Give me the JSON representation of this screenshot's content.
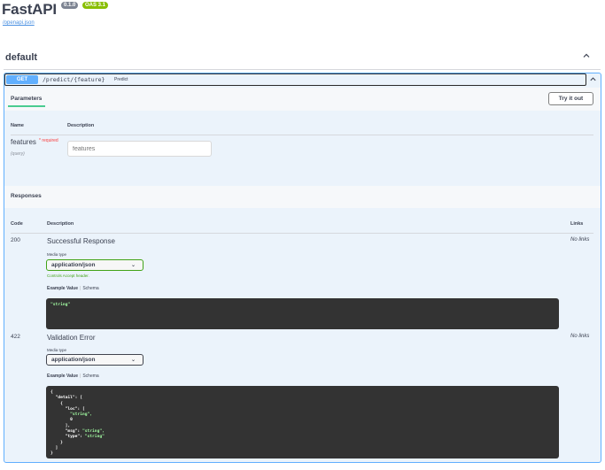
{
  "app": {
    "title": "FastAPI",
    "version_badge": "0.1.0",
    "oas_badge": "OAS 3.1",
    "spec_link": "/openapi.json"
  },
  "tag": {
    "name": "default",
    "chevron_icon": "chevron-up-icon"
  },
  "operation": {
    "method": "GET",
    "path": "/predict/{feature}",
    "summary": "Predict",
    "color": "#61affe"
  },
  "parameters": {
    "tab_label": "Parameters",
    "try_button": "Try it out",
    "col_name": "Name",
    "col_description": "Description",
    "items": [
      {
        "name": "features",
        "required_mark": "*",
        "required_label": "required",
        "in": "(query)",
        "placeholder": "features"
      }
    ]
  },
  "responses": {
    "title": "Responses",
    "col_code": "Code",
    "col_description": "Description",
    "col_links": "Links",
    "items": [
      {
        "code": "200",
        "description": "Successful Response",
        "links": "No links",
        "media_type_label": "Media type",
        "media_type": "application/json",
        "controls_note": "Controls Accept header.",
        "example_tab": "Example Value",
        "schema_tab": "Schema",
        "example": "\"string\""
      },
      {
        "code": "422",
        "description": "Validation Error",
        "links": "No links",
        "media_type_label": "Media type",
        "media_type": "application/json",
        "example_tab": "Example Value",
        "schema_tab": "Schema",
        "example_lines": [
          {
            "k": "{",
            "v": ""
          },
          {
            "k": "  \"detail\": [",
            "v": ""
          },
          {
            "k": "    {",
            "v": ""
          },
          {
            "k": "      \"loc\": [",
            "v": ""
          },
          {
            "k": "        ",
            "v": "\"string\","
          },
          {
            "k": "        0",
            "v": ""
          },
          {
            "k": "      ],",
            "v": ""
          },
          {
            "k": "      \"msg\": ",
            "v": "\"string\","
          },
          {
            "k": "      \"type\": ",
            "v": "\"string\""
          },
          {
            "k": "    }",
            "v": ""
          },
          {
            "k": "  ]",
            "v": ""
          },
          {
            "k": "}",
            "v": ""
          }
        ]
      }
    ]
  }
}
